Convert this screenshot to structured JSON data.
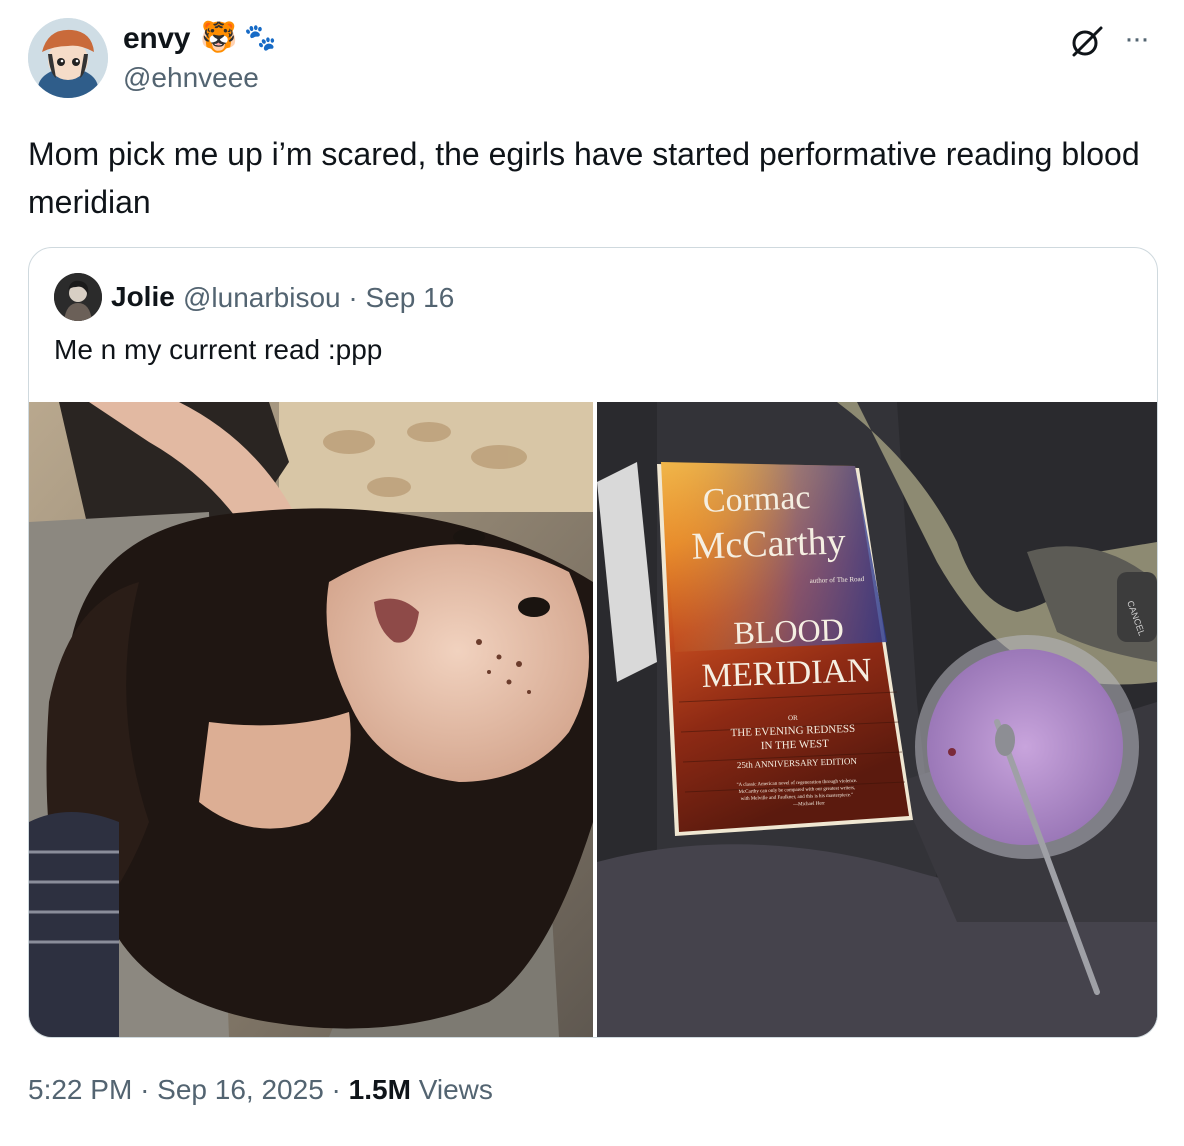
{
  "author": {
    "display_name": "envy",
    "emoji_1": "🐯",
    "emoji_2": "🐾",
    "handle": "@ehnveee"
  },
  "tweet": {
    "text": "Mom pick me up i’m scared, the egirls have started performative reading blood meridian"
  },
  "quoted": {
    "display_name": "Jolie",
    "handle": "@lunarbisou",
    "separator": "·",
    "date": "Sep 16",
    "text": "Me n my current read :ppp",
    "book": {
      "author_line1": "Cormac",
      "author_line2": "McCarthy",
      "subtitle": "author of The Road",
      "title_line1": "BLOOD",
      "title_line2": "MERIDIAN",
      "or": "OR",
      "alt_title_line1": "THE EVENING REDNESS",
      "alt_title_line2": "IN THE WEST",
      "edition": "25th ANNIVERSARY EDITION",
      "blurb_line1": "\"A classic American novel of regeneration through violence.",
      "blurb_line2": "McCarthy can only be compared with our greatest writers,",
      "blurb_line3": "with Melville and Faulkner, and this is his masterpiece.\"",
      "blurb_line4": "—Michael Herr"
    },
    "car_button_label": "CANCEL"
  },
  "footer": {
    "time": "5:22 PM",
    "separator": "·",
    "date": "Sep 16, 2025",
    "views_count": "1.5M",
    "views_label": "Views"
  },
  "icons": {
    "grok": "grok-icon",
    "more": "more-icon"
  },
  "colors": {
    "text_primary": "#0f1419",
    "text_secondary": "#536471",
    "border": "#cfd9de"
  }
}
